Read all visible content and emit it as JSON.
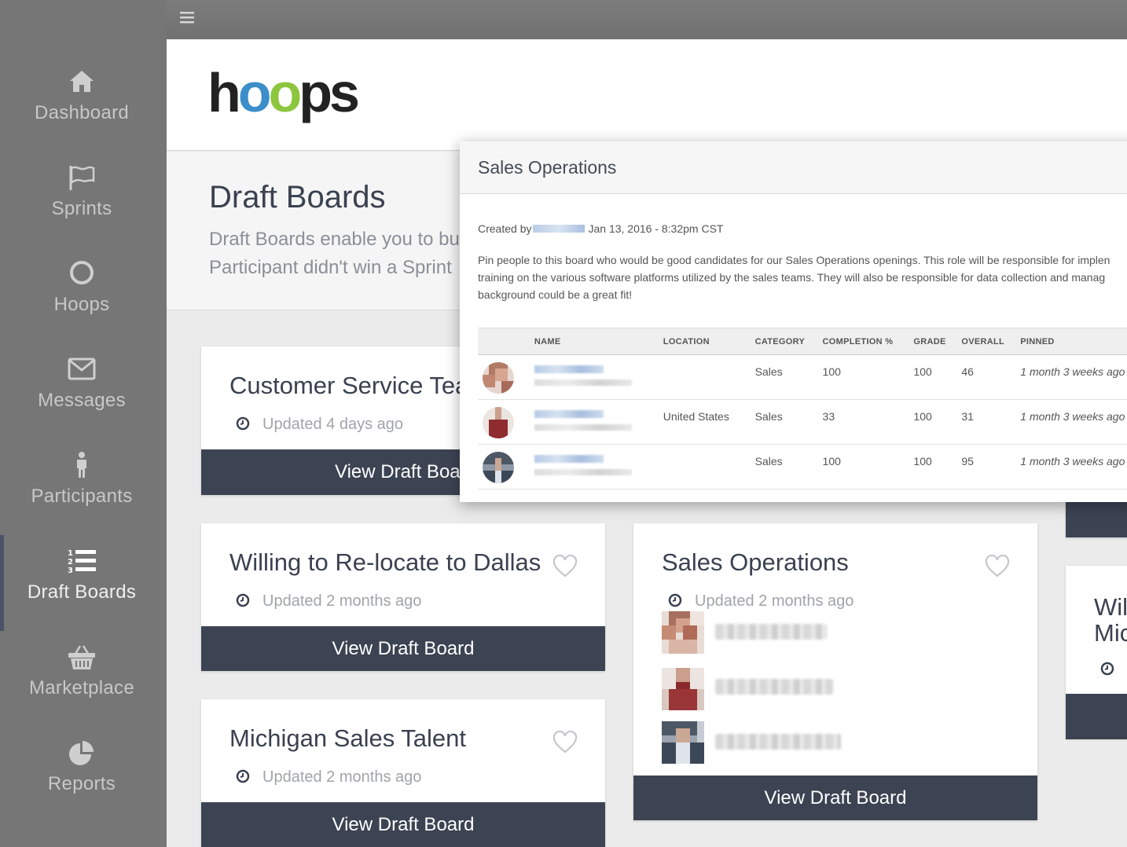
{
  "sidebar": {
    "items": [
      {
        "label": "Dashboard",
        "icon": "home-icon"
      },
      {
        "label": "Sprints",
        "icon": "flag-icon"
      },
      {
        "label": "Hoops",
        "icon": "circle-icon"
      },
      {
        "label": "Messages",
        "icon": "envelope-icon"
      },
      {
        "label": "Participants",
        "icon": "person-icon"
      },
      {
        "label": "Draft Boards",
        "icon": "numbered-list-icon",
        "active": true
      },
      {
        "label": "Marketplace",
        "icon": "basket-icon"
      },
      {
        "label": "Reports",
        "icon": "pie-chart-icon"
      }
    ]
  },
  "topbar": {
    "menu_icon": "hamburger-icon"
  },
  "brand": {
    "logo_text_pre": "h",
    "logo_o1": "o",
    "logo_o2": "o",
    "logo_text_post": "ps"
  },
  "intro": {
    "title": "Draft Boards",
    "description_line1": "Draft Boards enable you to bui",
    "description_line2": "Participant didn't win a Sprint"
  },
  "cards": [
    {
      "title": "Customer Service Tea",
      "updated": "Updated 4 days ago",
      "button": "View Draft Boar"
    },
    {
      "title": "Willing to Re-locate to Dallas",
      "updated": "Updated 2 months ago",
      "button": "View Draft Board"
    },
    {
      "title": "Michigan Sales Talent",
      "updated": "Updated 2 months ago",
      "button": "View Draft Board"
    },
    {
      "title": "Sales Operations",
      "updated": "Updated 2 months ago",
      "button": "View Draft Board"
    },
    {
      "title_line1": "Wil",
      "title_line2": "Mic"
    }
  ],
  "modal": {
    "title": "Sales Operations",
    "created_prefix": "Created by",
    "created_date": "Jan 13, 2016 - 8:32pm CST",
    "description_lines": [
      "Pin people to this board who would be good candidates for our Sales Operations openings.  This role will be responsible for implen",
      "training on the various software platforms utilized by the sales teams.  They will also be responsible for data collection and manag",
      "background could be a great fit!"
    ],
    "columns": [
      "NAME",
      "LOCATION",
      "CATEGORY",
      "COMPLETION %",
      "GRADE",
      "OVERALL",
      "PINNED"
    ],
    "rows": [
      {
        "location": "",
        "category": "Sales",
        "completion": "100",
        "grade": "100",
        "overall": "46",
        "pinned": "1 month 3 weeks ago l"
      },
      {
        "location": "United States",
        "category": "Sales",
        "completion": "33",
        "grade": "100",
        "overall": "31",
        "pinned": "1 month 3 weeks ago l"
      },
      {
        "location": "",
        "category": "Sales",
        "completion": "100",
        "grade": "100",
        "overall": "95",
        "pinned": "1 month 3 weeks ago l"
      }
    ]
  },
  "colors": {
    "sidebar": "#767676",
    "button": "#3c4353",
    "accent_blue": "#3b8ec9",
    "accent_green": "#8cc63f"
  }
}
